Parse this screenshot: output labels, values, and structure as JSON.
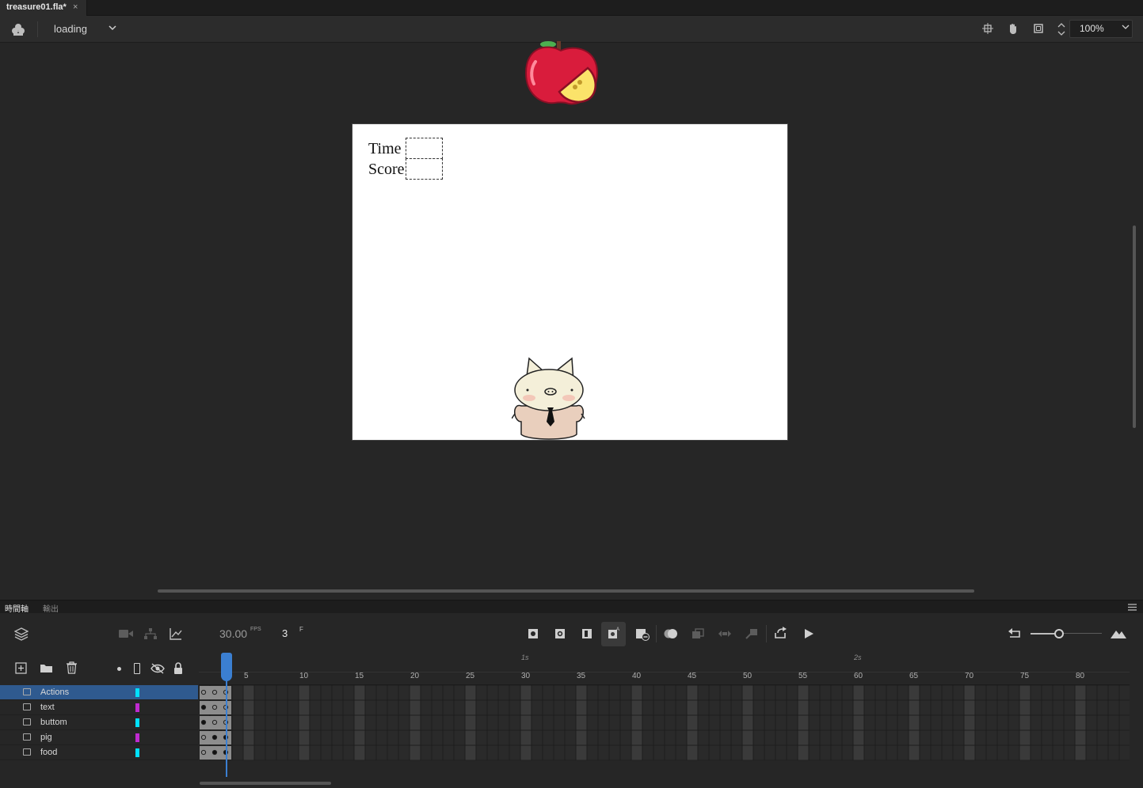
{
  "document": {
    "tab_title": "treasure01.fla*",
    "close_glyph": "×"
  },
  "edit_bar": {
    "scene_icon": "scene-icon",
    "scene_name": "loading",
    "zoom": "100%",
    "tool_icons": [
      "snap-icon",
      "hand-icon",
      "clip-icon",
      "zoom-stepper-icon"
    ]
  },
  "stage": {
    "labels": {
      "time": "Time",
      "score": "Score"
    }
  },
  "panel_tabs": [
    "時間軸",
    "輸出"
  ],
  "timeline": {
    "fps": "30.00",
    "fps_unit": "FPS",
    "current_frame": "3",
    "frame_unit": "F",
    "ruler_seconds": [
      "1s",
      "2s"
    ],
    "ruler_frames": [
      "5",
      "10",
      "15",
      "20",
      "25",
      "30",
      "35",
      "40",
      "45",
      "50",
      "55",
      "60",
      "65",
      "70",
      "75",
      "80"
    ],
    "layers": [
      {
        "name": "Actions",
        "color": "#00e0ff",
        "selected": true
      },
      {
        "name": "text",
        "color": "#c02ad0",
        "selected": false
      },
      {
        "name": "buttom",
        "color": "#00e0ff",
        "selected": false
      },
      {
        "name": "pig",
        "color": "#c02ad0",
        "selected": false
      },
      {
        "name": "food",
        "color": "#00e0ff",
        "selected": false
      }
    ]
  },
  "colors": {
    "accent": "#3b7fd1",
    "stage_bg": "#ffffff",
    "app_bg": "#262626"
  }
}
